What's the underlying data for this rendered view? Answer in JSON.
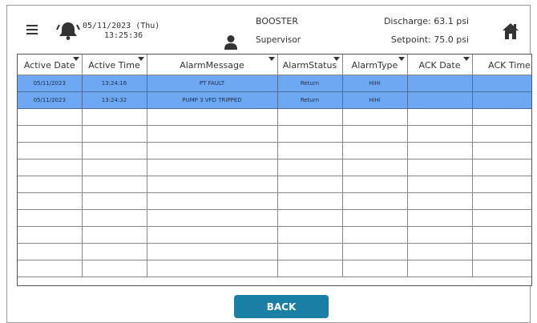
{
  "header": {
    "date": "05/11/2023 (Thu)",
    "time": "13:25:36",
    "project": "BOOSTER",
    "user_role": "Supervisor",
    "discharge": "Discharge:  63.1 psi",
    "setpoint": "Setpoint:  75.0 psi",
    "icons": {
      "menu": "hamburger-menu-icon",
      "bell": "alarm-bell-icon",
      "user": "user-icon",
      "home": "home-icon"
    }
  },
  "table": {
    "columns": [
      "Active Date",
      "Active Time",
      "AlarmMessage",
      "AlarmStatus",
      "AlarmType",
      "ACK Date",
      "ACK Time"
    ],
    "rows": [
      [
        "05/11/2023",
        "13:24:16",
        "PT FAULT",
        "Return",
        "HiHi",
        "",
        ""
      ],
      [
        "05/11/2023",
        "13:24:32",
        "PUMP 3 VFD TRIPPED",
        "Return",
        "HiHi",
        "",
        ""
      ],
      [
        "",
        "",
        "",
        "",
        "",
        "",
        ""
      ],
      [
        "",
        "",
        "",
        "",
        "",
        "",
        ""
      ],
      [
        "",
        "",
        "",
        "",
        "",
        "",
        ""
      ],
      [
        "",
        "",
        "",
        "",
        "",
        "",
        ""
      ],
      [
        "",
        "",
        "",
        "",
        "",
        "",
        ""
      ],
      [
        "",
        "",
        "",
        "",
        "",
        "",
        ""
      ],
      [
        "",
        "",
        "",
        "",
        "",
        "",
        ""
      ],
      [
        "",
        "",
        "",
        "",
        "",
        "",
        ""
      ],
      [
        "",
        "",
        "",
        "",
        "",
        "",
        ""
      ],
      [
        "",
        "",
        "",
        "",
        "",
        "",
        ""
      ]
    ],
    "selected_color": "#6fa8f2"
  },
  "back_label": "BACK",
  "colors": {
    "back_button": "#197fa5"
  }
}
